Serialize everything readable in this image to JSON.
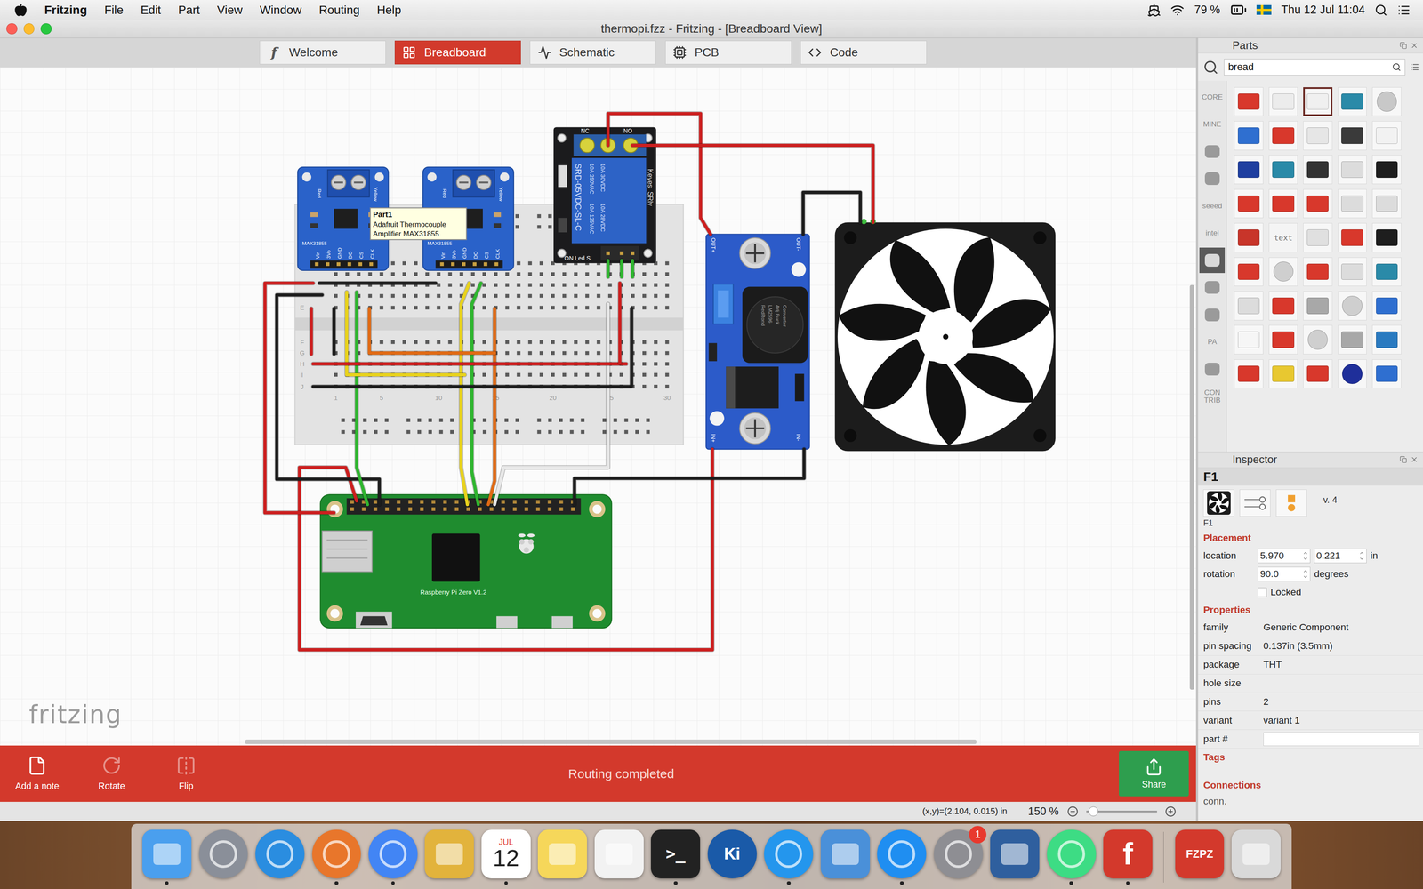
{
  "menubar": {
    "app": "Fritzing",
    "items": [
      "File",
      "Edit",
      "Part",
      "View",
      "Window",
      "Routing",
      "Help"
    ],
    "battery": "79 %",
    "clock": "Thu 12 Jul  11:04"
  },
  "window": {
    "title": "thermopi.fzz - Fritzing - [Breadboard View]"
  },
  "tabs": [
    {
      "label": "Welcome",
      "kind": "glyph",
      "glyph": "f",
      "selected": false
    },
    {
      "label": "Breadboard",
      "kind": "breadboard",
      "selected": true
    },
    {
      "label": "Schematic",
      "kind": "schematic",
      "selected": false
    },
    {
      "label": "PCB",
      "kind": "pcb",
      "selected": false
    },
    {
      "label": "Code",
      "kind": "code",
      "selected": false
    }
  ],
  "canvas": {
    "watermark": "fritzing",
    "tooltip": {
      "title": "Part1",
      "lines": [
        "Adafruit Thermocouple",
        "Amplifier MAX31855"
      ]
    },
    "thermocouple_boards": [
      {
        "label": "MAX31855",
        "terminals": [
          "Red",
          "Yellow"
        ],
        "pins": [
          "Vin",
          "3Vo",
          "GND",
          "DO",
          "CS",
          "CLK"
        ]
      },
      {
        "label": "MAX31855",
        "terminals": [
          "Red",
          "Yellow"
        ],
        "pins": [
          "Vin",
          "3Vo",
          "GND",
          "DO",
          "CS",
          "CLK"
        ]
      }
    ],
    "relay": {
      "terminals": [
        "NC",
        "NO"
      ],
      "model": "SRD-05VDC-SL-C",
      "ratings": [
        "10A 250VAC",
        "10A 125VAC",
        "10A 30VDC",
        "10A 28VDC"
      ],
      "brand": "Keyes_SRly",
      "led": "ON Led S"
    },
    "buck_converter": {
      "pins": [
        "OUT+",
        "OUT-",
        "IN+",
        "IN-"
      ],
      "label": [
        "RedRond",
        "LM2596",
        "Adj Buck",
        "Converter"
      ]
    },
    "pi": {
      "label": "Raspberry Pi Zero V1.2"
    },
    "breadboard": {
      "rows": [
        "E",
        "F",
        "G",
        "H",
        "I",
        "J"
      ],
      "columns": [
        "1",
        "5",
        "10",
        "15",
        "20",
        "25",
        "30"
      ]
    }
  },
  "toolbar": {
    "buttons": [
      {
        "label": "Add a note",
        "kind": "note",
        "disabled": false
      },
      {
        "label": "Rotate",
        "kind": "rotate",
        "disabled": true
      },
      {
        "label": "Flip",
        "kind": "flip",
        "disabled": true
      }
    ],
    "status": "Routing completed",
    "share": "Share"
  },
  "status_bar": {
    "coords": "(x,y)=(2.104, 0.015) in",
    "zoom": "150 %",
    "zoom_level": 0.1
  },
  "parts": {
    "title": "Parts",
    "search": "bread",
    "bins": [
      {
        "kind": "text",
        "label": "CORE",
        "selected": false
      },
      {
        "kind": "text",
        "label": "MINE",
        "selected": false
      },
      {
        "kind": "icon",
        "selected": false
      },
      {
        "kind": "icon",
        "selected": false
      },
      {
        "kind": "text",
        "label": "seeed",
        "selected": false
      },
      {
        "kind": "text",
        "label": "intel",
        "selected": false
      },
      {
        "kind": "icon",
        "selected": true
      },
      {
        "kind": "icon",
        "selected": false
      },
      {
        "kind": "icon",
        "selected": false
      },
      {
        "kind": "text",
        "label": "PA",
        "selected": false
      },
      {
        "kind": "icon",
        "selected": false
      },
      {
        "kind": "text",
        "label": "CON TRIB",
        "selected": false
      }
    ],
    "items": [
      {
        "kind": "board",
        "color": "#d8382c",
        "selected": false
      },
      {
        "kind": "board",
        "color": "#ececec",
        "selected": false
      },
      {
        "kind": "board",
        "color": "#f0f0f0",
        "selected": true
      },
      {
        "kind": "board",
        "color": "#2a8aa8",
        "selected": false
      },
      {
        "kind": "round",
        "color": "#c8c8c8",
        "selected": false
      },
      {
        "kind": "board",
        "color": "#2f6fd0",
        "selected": false
      },
      {
        "kind": "board",
        "color": "#d8382c",
        "selected": false
      },
      {
        "kind": "board",
        "color": "#e6e6e6",
        "selected": false
      },
      {
        "kind": "board",
        "color": "#3a3a3a",
        "selected": false
      },
      {
        "kind": "board",
        "color": "#f2f2f2",
        "selected": false
      },
      {
        "kind": "board",
        "color": "#1f3fa0",
        "selected": false
      },
      {
        "kind": "board",
        "color": "#2a8aa8",
        "selected": false
      },
      {
        "kind": "board",
        "color": "#333333",
        "selected": false
      },
      {
        "kind": "board",
        "color": "#dcdcdc",
        "selected": false
      },
      {
        "kind": "board",
        "color": "#1e1e1e",
        "selected": false
      },
      {
        "kind": "board",
        "color": "#d8382c",
        "selected": false
      },
      {
        "kind": "board",
        "color": "#d8382c",
        "selected": false
      },
      {
        "kind": "board",
        "color": "#d8382c",
        "selected": false
      },
      {
        "kind": "board",
        "color": "#dcdcdc",
        "selected": false
      },
      {
        "kind": "board",
        "color": "#dcdcdc",
        "selected": false
      },
      {
        "kind": "board",
        "color": "#c8352a",
        "selected": false
      },
      {
        "kind": "text",
        "label": "text",
        "color": "#f4f4f4",
        "selected": false
      },
      {
        "kind": "board",
        "color": "#e0e0e0",
        "selected": false
      },
      {
        "kind": "board",
        "color": "#d8382c",
        "selected": false
      },
      {
        "kind": "board",
        "color": "#1e1e1e",
        "selected": false
      },
      {
        "kind": "board",
        "color": "#d8382c",
        "selected": false
      },
      {
        "kind": "round",
        "color": "#cfcfcf",
        "selected": false
      },
      {
        "kind": "board",
        "color": "#d8382c",
        "selected": false
      },
      {
        "kind": "board",
        "color": "#dcdcdc",
        "selected": false
      },
      {
        "kind": "board",
        "color": "#2a8aa8",
        "selected": false
      },
      {
        "kind": "board",
        "color": "#dcdcdc",
        "selected": false
      },
      {
        "kind": "board",
        "color": "#d8382c",
        "selected": false
      },
      {
        "kind": "board",
        "color": "#a8a8a8",
        "selected": false
      },
      {
        "kind": "round",
        "color": "#cfcfcf",
        "selected": false
      },
      {
        "kind": "board",
        "color": "#2f6fd0",
        "selected": false
      },
      {
        "kind": "board",
        "color": "#f6f6f6",
        "selected": false
      },
      {
        "kind": "board",
        "color": "#d8382c",
        "selected": false
      },
      {
        "kind": "round",
        "color": "#cfcfcf",
        "selected": false
      },
      {
        "kind": "board",
        "color": "#a8a8a8",
        "selected": false
      },
      {
        "kind": "board",
        "color": "#2a7ac0",
        "selected": false
      },
      {
        "kind": "board",
        "color": "#d8382c",
        "selected": false
      },
      {
        "kind": "board",
        "color": "#e8c830",
        "selected": false
      },
      {
        "kind": "board",
        "color": "#d8382c",
        "selected": false
      },
      {
        "kind": "round",
        "color": "#1f2f9a",
        "selected": false
      },
      {
        "kind": "board",
        "color": "#2f6fd0",
        "selected": false
      }
    ]
  },
  "inspector": {
    "title": "Inspector",
    "part": "F1",
    "caption": "F1",
    "version": "v. 4",
    "placement": {
      "heading": "Placement",
      "location_label": "location",
      "x": "5.970",
      "y": "0.221",
      "unit": "in",
      "rotation_label": "rotation",
      "rotation": "90.0",
      "rotation_unit": "degrees",
      "locked_label": "Locked",
      "locked": false
    },
    "properties": {
      "heading": "Properties",
      "rows": [
        {
          "name": "family",
          "value": "Generic Component",
          "kind": "text"
        },
        {
          "name": "pin spacing",
          "value": "0.137in (3.5mm)",
          "kind": "text"
        },
        {
          "name": "package",
          "value": "THT",
          "kind": "text"
        },
        {
          "name": "hole size",
          "value": "",
          "kind": "text"
        },
        {
          "name": "pins",
          "value": "2",
          "kind": "text"
        },
        {
          "name": "variant",
          "value": "variant 1",
          "kind": "text"
        },
        {
          "name": "part #",
          "value": "",
          "kind": "input"
        }
      ]
    },
    "tags": "Tags",
    "connections": "Connections",
    "conn": "conn."
  },
  "dock": {
    "apps": [
      {
        "kind": "square",
        "color": "#4a9fee",
        "running": true
      },
      {
        "kind": "circle",
        "color": "#8a8f99",
        "running": false
      },
      {
        "kind": "circle",
        "color": "#2a8de0",
        "running": false
      },
      {
        "kind": "circle",
        "color": "#e8762b",
        "running": true
      },
      {
        "kind": "circle",
        "color": "#4285f4",
        "running": true
      },
      {
        "kind": "square",
        "color": "#e2b33c",
        "running": false
      },
      {
        "kind": "calendar",
        "color": "#ffffff",
        "month": "JUL",
        "day": "12",
        "running": true
      },
      {
        "kind": "square",
        "color": "#f6d75a",
        "running": false
      },
      {
        "kind": "square",
        "color": "#f2f2f2",
        "running": false
      },
      {
        "kind": "terminal",
        "color": "#222222",
        "label": ">_",
        "running": true
      },
      {
        "kind": "circle",
        "color": "#1a5aa8",
        "label": "Ki",
        "running": false
      },
      {
        "kind": "circle",
        "color": "#2496ed",
        "running": true
      },
      {
        "kind": "square",
        "color": "#4a90d9",
        "running": false
      },
      {
        "kind": "circle",
        "color": "#1f8ef1",
        "running": true
      },
      {
        "kind": "circle",
        "color": "#8e8e93",
        "badge": "1",
        "running": false
      },
      {
        "kind": "square",
        "color": "#2f5f9e",
        "running": false
      },
      {
        "kind": "circle",
        "color": "#3ddc84",
        "running": true
      },
      {
        "kind": "glyph",
        "color": "#d3392c",
        "label": "f",
        "running": true
      },
      {
        "kind": "separator"
      },
      {
        "kind": "doc",
        "color": "#d3392c",
        "label": "FZPZ",
        "running": false
      },
      {
        "kind": "square",
        "color": "#d9d9d9",
        "running": false
      }
    ]
  }
}
